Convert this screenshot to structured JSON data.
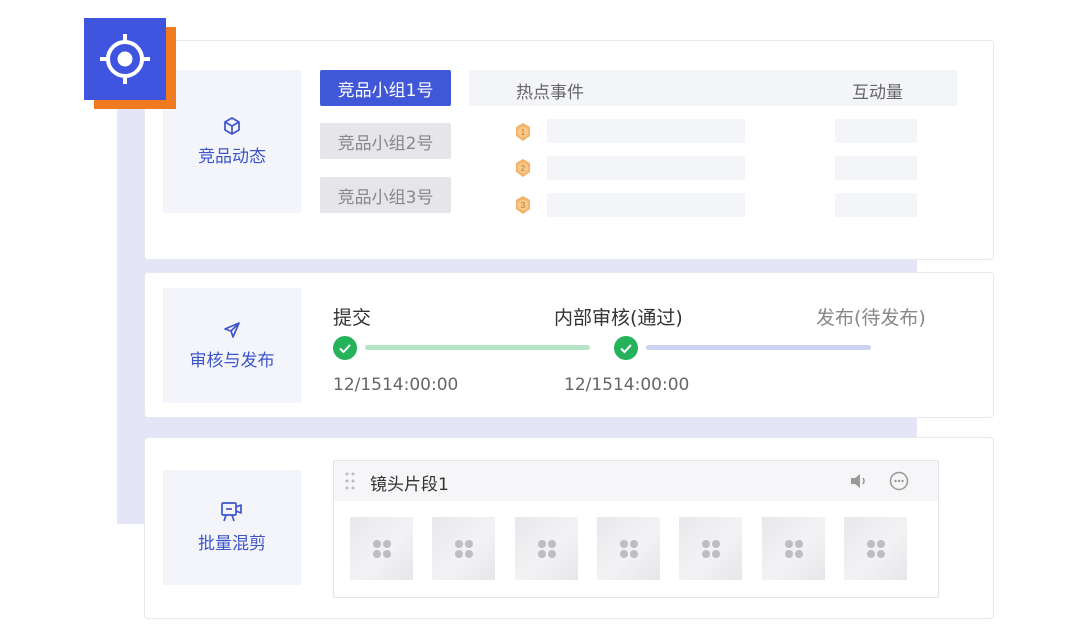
{
  "competitor": {
    "label": "竞品动态",
    "groups": [
      {
        "label": "竞品小组1号",
        "active": true
      },
      {
        "label": "竞品小组2号",
        "active": false
      },
      {
        "label": "竞品小组3号",
        "active": false
      }
    ],
    "columns": {
      "event": "热点事件",
      "interaction": "互动量"
    },
    "ranks": [
      "1",
      "2",
      "3"
    ]
  },
  "review": {
    "label": "审核与发布",
    "steps": [
      {
        "label": "提交",
        "date": "12/1514:00:00",
        "done": true
      },
      {
        "label": "内部审核(通过)",
        "date": "12/1514:00:00",
        "done": true
      },
      {
        "label": "发布(待发布)",
        "date": "",
        "done": false
      }
    ],
    "colors": {
      "done": "#24b35a",
      "line_done": "#b5e4c6",
      "line_pending": "#ccd2f2"
    }
  },
  "mix": {
    "label": "批量混剪",
    "clip_title": "镜头片段1",
    "thumbnail_count": 7
  },
  "colors": {
    "accent": "#3f55e0",
    "accent_shadow": "#f07a1f"
  }
}
